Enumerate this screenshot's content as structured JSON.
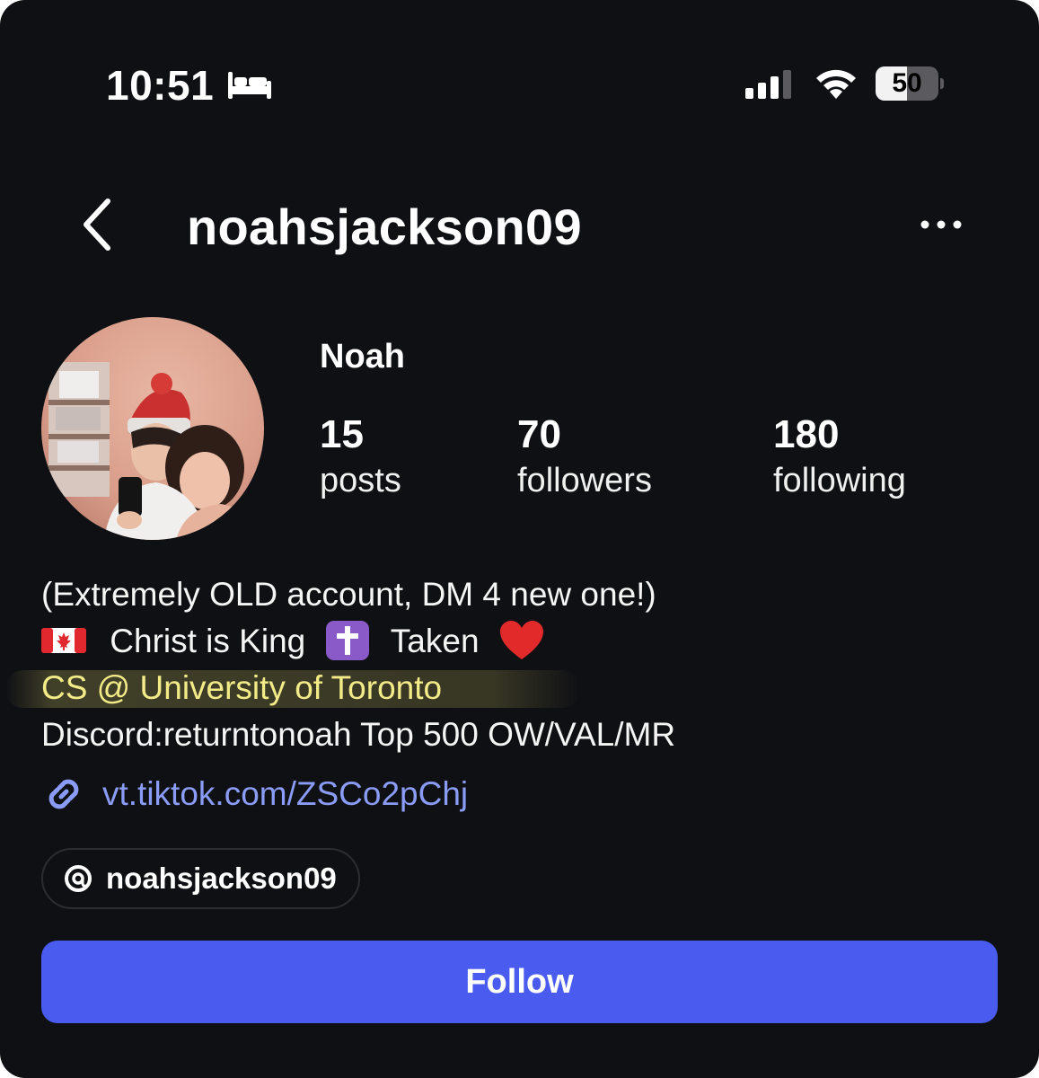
{
  "status_bar": {
    "time": "10:51",
    "battery": "50",
    "battery_level": 0.5,
    "icons": [
      "bed-icon",
      "cellular-signal-icon",
      "wifi-icon",
      "battery-icon"
    ]
  },
  "header": {
    "username": "noahsjackson09",
    "icons": [
      "back-chevron-icon",
      "more-options-icon"
    ]
  },
  "profile": {
    "display_name": "Noah",
    "stats": {
      "posts": {
        "value": "15",
        "label": "posts"
      },
      "followers": {
        "value": "70",
        "label": "followers"
      },
      "following": {
        "value": "180",
        "label": "following"
      }
    }
  },
  "bio": {
    "line1": "(Extremely OLD account, DM 4 new one!)",
    "line2_text1": "Christ is King",
    "line2_text2": "Taken",
    "line2_emojis": [
      "canada-flag-icon",
      "latin-cross-icon",
      "red-heart-icon"
    ],
    "line3": "CS @ University of Toronto",
    "line4": "Discord:returntonoah Top 500 OW/VAL/MR"
  },
  "link": {
    "text": "vt.tiktok.com/ZSCo2pChj",
    "icon": "link-icon"
  },
  "threads": {
    "handle": "noahsjackson09",
    "icon": "threads-icon"
  },
  "actions": {
    "follow_label": "Follow"
  },
  "colors": {
    "background": "#0f1014",
    "follow_button": "#4a5cf0",
    "link": "#8a9cf5",
    "highlight": "#f3eb88",
    "chip_border": "#2c2d33"
  }
}
